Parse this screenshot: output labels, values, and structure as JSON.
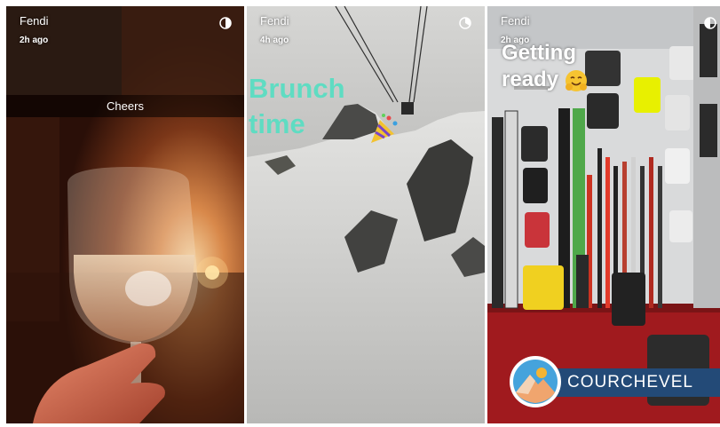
{
  "stories": [
    {
      "username": "Fendi",
      "time_ago": "2h ago",
      "caption": "Cheers"
    },
    {
      "username": "Fendi",
      "time_ago": "4h ago",
      "sticker_text": {
        "line1": "Brunch",
        "line2": "time"
      },
      "sticker_color": "#5fdcc2",
      "sticker_icon": "party-popper-icon"
    },
    {
      "username": "Fendi",
      "time_ago": "2h ago",
      "sticker_text": {
        "line1": "Getting",
        "line2": "ready"
      },
      "sticker_icon": "hugging-face-icon",
      "geofilter": {
        "label": "COURCHEVEL",
        "color": "#234a77"
      }
    }
  ],
  "icons": {
    "timer": "story-timer-icon"
  }
}
